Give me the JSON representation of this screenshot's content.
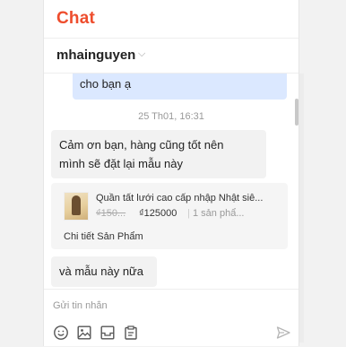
{
  "header": {
    "title": "Chat"
  },
  "conversation": {
    "username": "mhainguyen"
  },
  "messages": {
    "outgoing_1": "cho bạn ạ",
    "timestamp": "25 Th01, 16:31",
    "incoming_1_line1": "Cảm ơn bạn, hàng cũng tốt nên",
    "incoming_1_line2": "mình sẽ đặt lại mẫu này",
    "incoming_2": "và mẫu này nữa"
  },
  "product": {
    "name": "Quần tất lưới cao cấp nhập Nhật siê...",
    "old_price": "₫150...",
    "price": "₫125000",
    "separator": "|",
    "sold": "1 sản phẩ...",
    "detail_link": "Chi tiết Sản Phẩm"
  },
  "composer": {
    "placeholder": "Gửi tin nhắn"
  },
  "icons": [
    "emoji-icon",
    "image-icon",
    "product-icon",
    "order-icon",
    "send-icon"
  ],
  "colors": {
    "brand": "#ee4d2d",
    "outgoing_bubble": "#dbe8ff",
    "incoming_bubble": "#f2f2f2"
  }
}
